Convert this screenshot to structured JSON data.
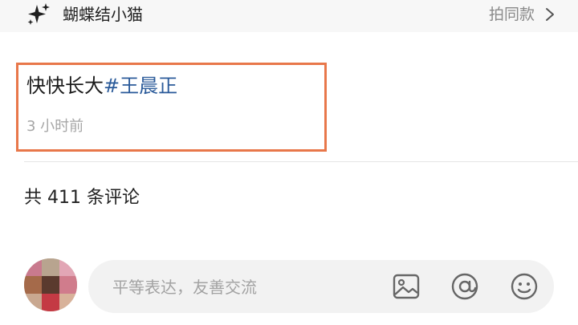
{
  "sound": {
    "icon": "sparkle-icon",
    "title": "蝴蝶结小猫",
    "action_label": "拍同款"
  },
  "post": {
    "caption_text": "快快长大",
    "caption_hashtag": "#王晨正",
    "time": "3 小时前"
  },
  "comments": {
    "count_label": "共 411 条评论"
  },
  "composer": {
    "placeholder": "平等表达，友善交流",
    "icons": [
      "image-icon",
      "at-icon",
      "emoji-icon"
    ]
  },
  "colors": {
    "hashtag": "#2b5b9a",
    "highlight_border": "#e8774a",
    "muted_text": "#a6a6a6"
  }
}
